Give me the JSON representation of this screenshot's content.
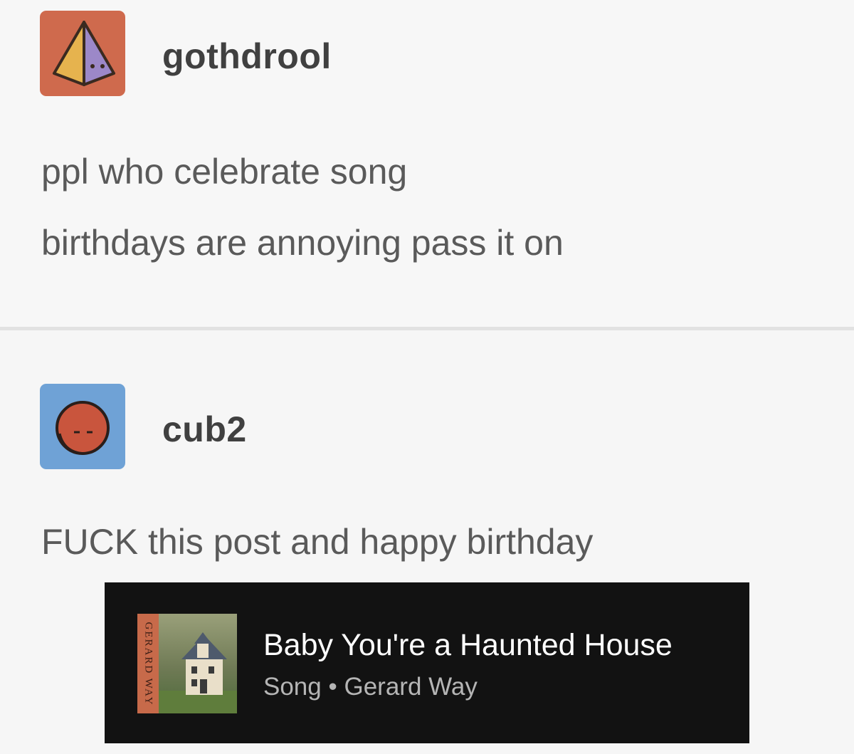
{
  "posts": [
    {
      "username": "gothdrool",
      "avatar_icon": "pyramid-face-avatar-icon",
      "avatar_bg": "#cf6a4d",
      "lines": [
        "ppl who celebrate song",
        "birthdays are annoying pass it on"
      ]
    },
    {
      "username": "cub2",
      "avatar_icon": "sleepy-ball-avatar-icon",
      "avatar_bg": "#6fa2d6",
      "lines": [
        "FUCK this post and happy birthday"
      ]
    }
  ],
  "spotify_embed": {
    "title": "Baby You're a Haunted House",
    "type_label": "Song",
    "separator": "•",
    "artist": "Gerard Way",
    "album_spine_text": "GERARD WAY",
    "background": "#121212"
  }
}
